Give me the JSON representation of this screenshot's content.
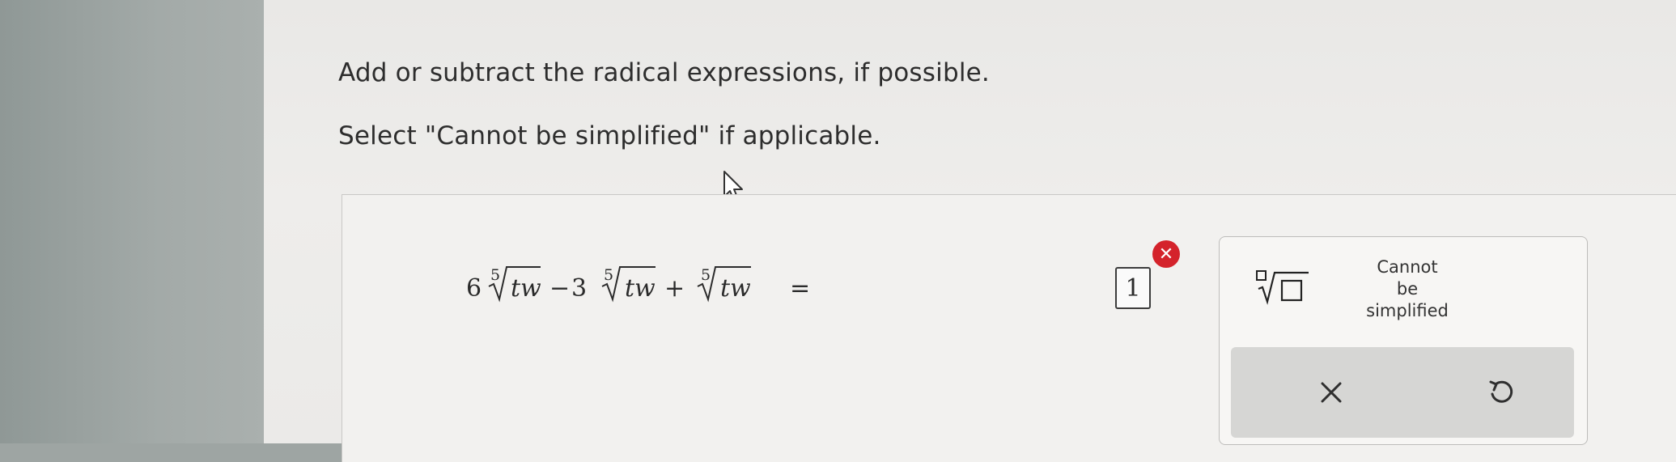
{
  "instructions": {
    "line1": "Add or subtract the radical expressions, if possible.",
    "line2": "Select \"Cannot be simplified\" if applicable."
  },
  "problem": {
    "terms": [
      {
        "coefficient": "6",
        "index": "5",
        "radicand": "tw",
        "operator_after": "−"
      },
      {
        "coefficient": "3",
        "index": "5",
        "radicand": "tw",
        "operator_after": "+"
      },
      {
        "coefficient": "",
        "index": "5",
        "radicand": "tw",
        "operator_after": ""
      }
    ],
    "equals": "=",
    "answer_value": "1",
    "answer_status": "incorrect"
  },
  "keypad": {
    "radical_key_icon": "nth-root-template-icon",
    "cannot_line1": "Cannot",
    "cannot_line2": "be",
    "cannot_line3": "simplified",
    "clear_icon": "close-icon",
    "undo_icon": "undo-icon"
  },
  "colors": {
    "error_red": "#d4232b",
    "action_bar": "#d6d6d4",
    "screen_bg": "#eceae8"
  }
}
